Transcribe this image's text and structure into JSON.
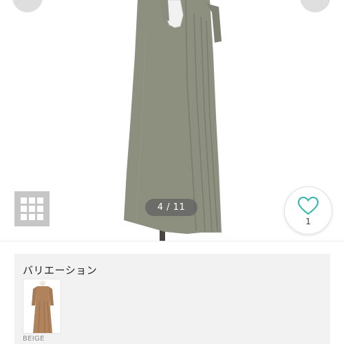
{
  "gallery": {
    "counter": "4 / 11",
    "favorite_count": "1",
    "colors": {
      "dress": "#8d8f7f",
      "heart": "#2fb5ad",
      "grid_bg": "#c6c6c6"
    }
  },
  "variation": {
    "title": "バリエーション",
    "items": [
      {
        "label": "BEIGE",
        "color": "#b0835c"
      }
    ]
  }
}
